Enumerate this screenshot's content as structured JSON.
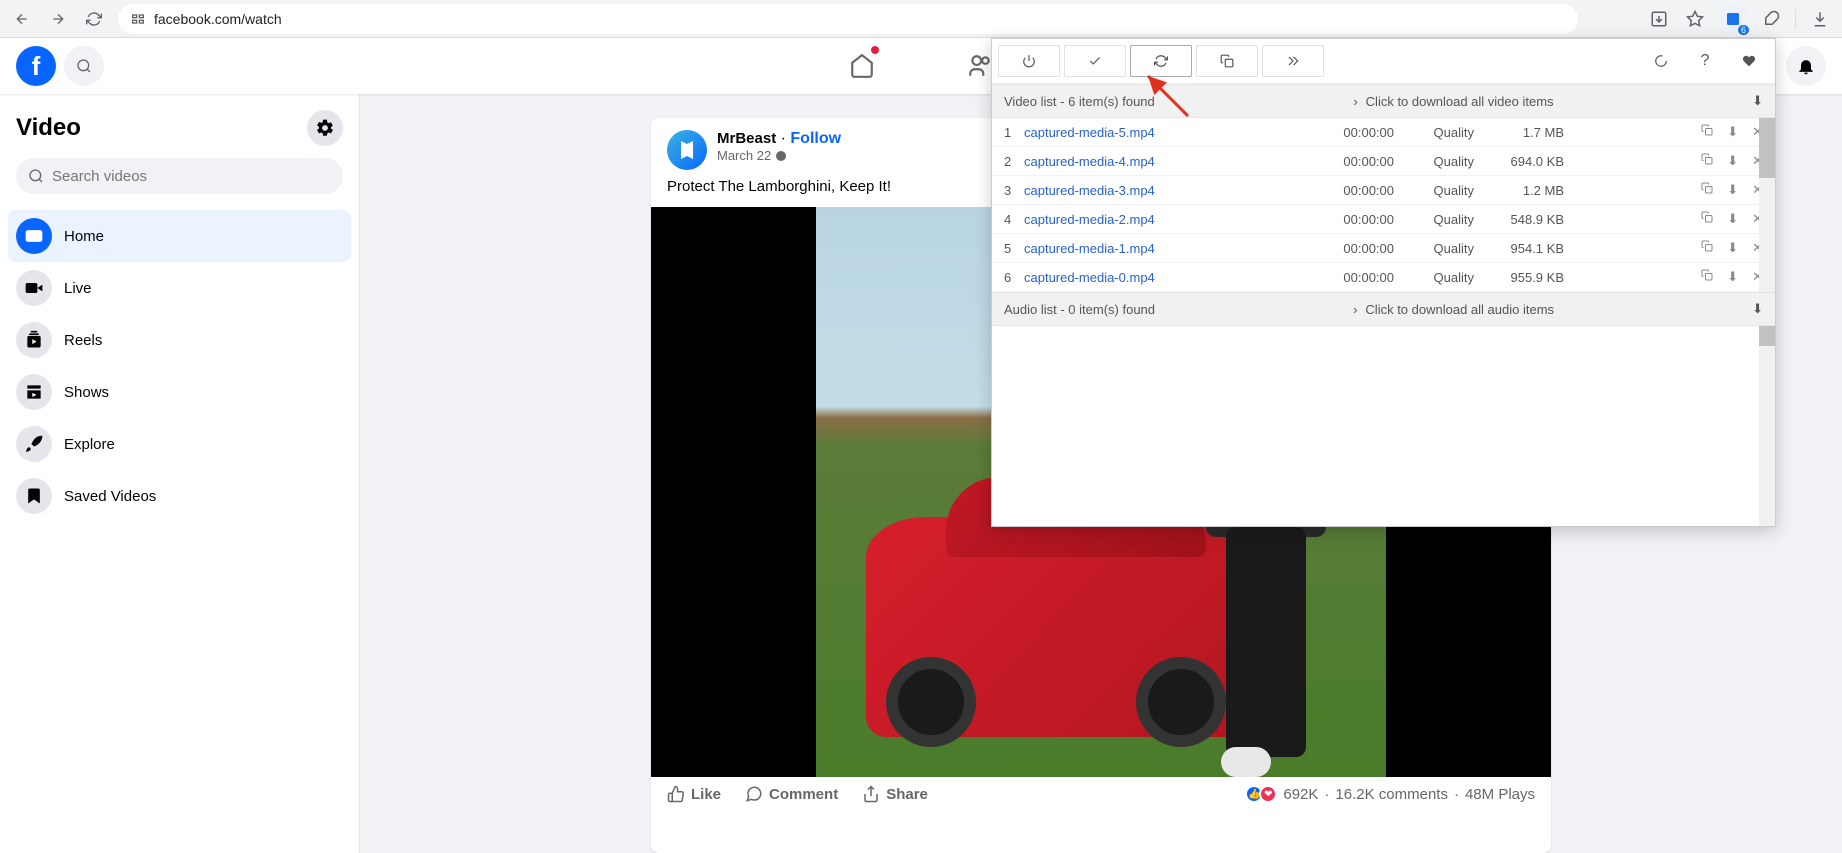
{
  "browser": {
    "url": "facebook.com/watch",
    "extension_badge": "6"
  },
  "sidebar": {
    "title": "Video",
    "search_placeholder": "Search videos",
    "items": [
      {
        "label": "Home",
        "active": true
      },
      {
        "label": "Live",
        "active": false
      },
      {
        "label": "Reels",
        "active": false
      },
      {
        "label": "Shows",
        "active": false
      },
      {
        "label": "Explore",
        "active": false
      },
      {
        "label": "Saved Videos",
        "active": false
      }
    ]
  },
  "post": {
    "author": "MrBeast",
    "follow": "Follow",
    "dot": " · ",
    "date": "March 22",
    "title": "Protect The Lamborghini, Keep It!",
    "like": "Like",
    "comment": "Comment",
    "share": "Share",
    "reactions": "692K",
    "comments_stat": "16.2K comments",
    "plays_stat": "48M Plays",
    "stat_sep": " · "
  },
  "extension": {
    "video_header": "Video list - 6 item(s) found",
    "video_dl_all": "Click to download all video items",
    "audio_header": "Audio list - 0 item(s) found",
    "audio_dl_all": "Click to download all audio items",
    "items": [
      {
        "idx": "1",
        "name": "captured-media-5.mp4",
        "dur": "00:00:00",
        "qual": "Quality",
        "size": "1.7 MB"
      },
      {
        "idx": "2",
        "name": "captured-media-4.mp4",
        "dur": "00:00:00",
        "qual": "Quality",
        "size": "694.0 KB"
      },
      {
        "idx": "3",
        "name": "captured-media-3.mp4",
        "dur": "00:00:00",
        "qual": "Quality",
        "size": "1.2 MB"
      },
      {
        "idx": "4",
        "name": "captured-media-2.mp4",
        "dur": "00:00:00",
        "qual": "Quality",
        "size": "548.9 KB"
      },
      {
        "idx": "5",
        "name": "captured-media-1.mp4",
        "dur": "00:00:00",
        "qual": "Quality",
        "size": "954.1 KB"
      },
      {
        "idx": "6",
        "name": "captured-media-0.mp4",
        "dur": "00:00:00",
        "qual": "Quality",
        "size": "955.9 KB"
      }
    ]
  }
}
